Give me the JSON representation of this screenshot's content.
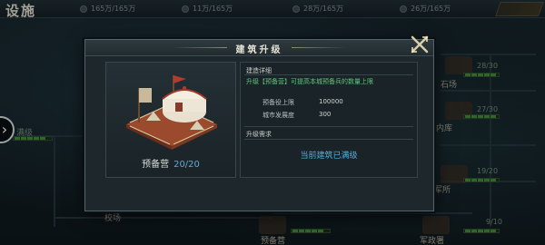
{
  "topbar": {
    "title": "设施",
    "resources": [
      "165万/165万",
      "11万/165万",
      "28万/165万",
      "26万/165万"
    ]
  },
  "background": {
    "labels": [
      "预备营",
      "军政署",
      "校场",
      "石场",
      "内库",
      "军所"
    ],
    "counts": [
      "28/30",
      "27/30",
      "19/20",
      "9/10"
    ],
    "left_tag": "满级"
  },
  "modal": {
    "title": "建筑升级",
    "building": {
      "name": "预备营",
      "level": "20/20"
    },
    "details": {
      "section_title": "建造详细",
      "description": "升级【预备营】可提高本城预备兵的数量上限",
      "stats": [
        {
          "label": "预备役上限",
          "value": "100000"
        },
        {
          "label": "城市发展度",
          "value": "300"
        }
      ]
    },
    "requirements": {
      "section_title": "升级需求",
      "status": "当前建筑已满级"
    }
  },
  "colors": {
    "accent_green": "#5fc47a",
    "accent_blue": "#4fb0dd",
    "panel_bg": "#1e282c"
  },
  "icons": [
    "close-icon",
    "expand-arrow-icon",
    "military-camp-icon"
  ]
}
